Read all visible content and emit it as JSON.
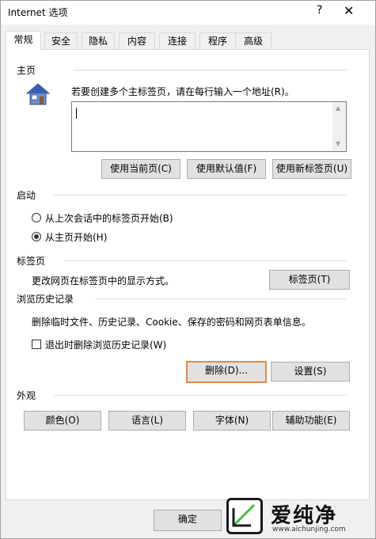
{
  "window": {
    "title": "Internet 选项",
    "help_label": "?",
    "close_label": "✕"
  },
  "tabs": [
    {
      "label": "常规",
      "active": true
    },
    {
      "label": "安全",
      "active": false
    },
    {
      "label": "隐私",
      "active": false
    },
    {
      "label": "内容",
      "active": false
    },
    {
      "label": "连接",
      "active": false
    },
    {
      "label": "程序",
      "active": false
    },
    {
      "label": "高级",
      "active": false
    }
  ],
  "homepage": {
    "section_label": "主页",
    "description": "若要创建多个主标签页，请在每行输入一个地址(R)。",
    "value": "",
    "buttons": {
      "use_current": "使用当前页(C)",
      "use_default": "使用默认值(F)",
      "use_new_tab": "使用新标签页(U)"
    },
    "icon": "house-icon"
  },
  "startup": {
    "section_label": "启动",
    "options": [
      {
        "label": "从上次会话中的标签页开始(B)",
        "selected": false
      },
      {
        "label": "从主页开始(H)",
        "selected": true
      }
    ]
  },
  "tabs_section": {
    "section_label": "标签页",
    "description": "更改网页在标签页中的显示方式。",
    "button": "标签页(T)"
  },
  "history": {
    "section_label": "浏览历史记录",
    "description": "删除临时文件、历史记录、Cookie、保存的密码和网页表单信息。",
    "checkbox_label": "退出时删除浏览历史记录(W)",
    "checkbox_checked": false,
    "delete_button": "删除(D)...",
    "settings_button": "设置(S)"
  },
  "appearance": {
    "section_label": "外观",
    "buttons": {
      "colors": "颜色(O)",
      "languages": "语言(L)",
      "fonts": "字体(N)",
      "accessibility": "辅助功能(E)"
    }
  },
  "footer": {
    "ok_button": "确定"
  },
  "watermark": {
    "text": "爱纯净",
    "url": "www.aichunjing.com"
  },
  "colors": {
    "focus_border": "#e28b49",
    "button_bg": "#e1e1e1",
    "dialog_bg": "#f0f0f0"
  }
}
